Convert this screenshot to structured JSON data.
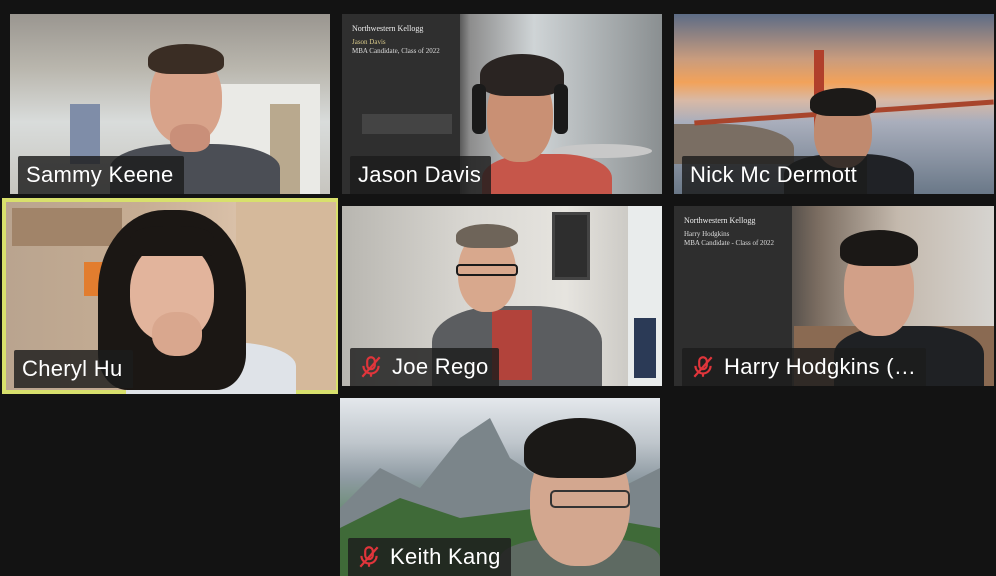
{
  "meeting": {
    "participants": [
      {
        "name": "Sammy Keene",
        "muted": false
      },
      {
        "name": "Jason Davis",
        "muted": false
      },
      {
        "name": "Nick Mc Dermott",
        "muted": false
      },
      {
        "name": "Cheryl Hu",
        "muted": false,
        "active_speaker": true
      },
      {
        "name": "Joe Rego",
        "muted": true
      },
      {
        "name": "Harry Hodgkins (…",
        "muted": true
      },
      {
        "name": "Keith Kang",
        "muted": true
      }
    ]
  },
  "backgrounds": {
    "jason": {
      "org": "Northwestern Kellogg",
      "name": "Jason Davis",
      "line1": "MBA Candidate, Class of 2022"
    },
    "harry": {
      "org": "Northwestern Kellogg",
      "name": "Harry Hodgkins",
      "line1": "MBA Candidate - Class of 2022"
    }
  },
  "colors": {
    "active_border": "#d8e06c",
    "mute_icon": "#e0353b",
    "background": "#131313"
  }
}
